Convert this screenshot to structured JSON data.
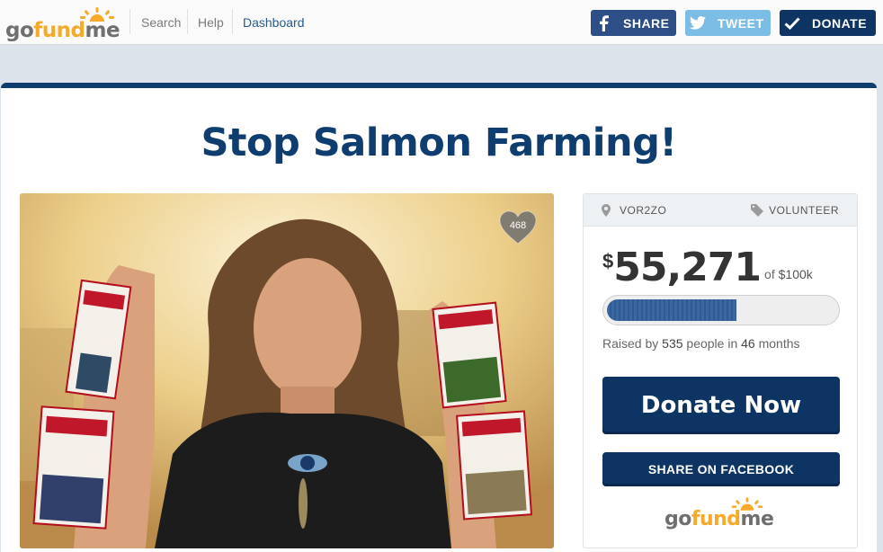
{
  "header": {
    "logo": "gofundme",
    "nav": {
      "search": "Search",
      "help": "Help",
      "dashboard": "Dashboard"
    },
    "buttons": {
      "share": "SHARE",
      "tweet": "TWEET",
      "donate": "DONATE"
    }
  },
  "campaign": {
    "title": "Stop Salmon Farming!",
    "likes": "468",
    "location": "VOR2ZO",
    "category": "VOLUNTEER",
    "currency": "$",
    "amount": "55,271",
    "goal_prefix": "of",
    "goal": "$100k",
    "progress": 0.55,
    "raised_prefix": "Raised by",
    "people": "535",
    "people_suffix": "people in",
    "months": "46",
    "months_suffix": "months",
    "donate_label": "Donate Now",
    "share_facebook_label": "SHARE ON FACEBOOK"
  },
  "colors": {
    "navy": "#0e3464",
    "title": "#103d6f",
    "facebook": "#2d4e86",
    "twitter": "#7cbde6",
    "logo_orange": "#f7a928"
  },
  "icons": [
    "facebook-icon",
    "twitter-icon",
    "check-icon",
    "heart-icon",
    "location-pin-icon",
    "tag-icon",
    "sun-icon"
  ]
}
